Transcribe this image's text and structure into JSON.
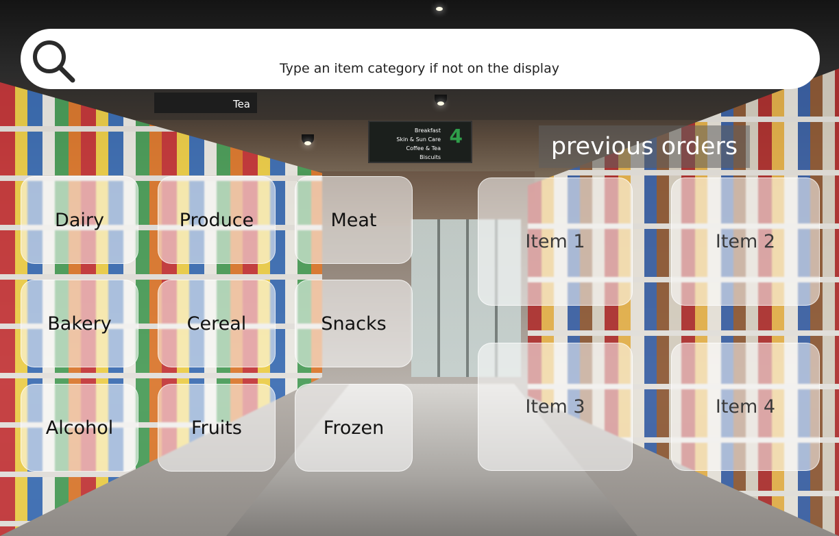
{
  "search": {
    "placeholder": "Type an item category if not on the display",
    "icon": "search-icon"
  },
  "background": {
    "tea_sign": "Tea",
    "aisle_sign": {
      "lines": [
        "Breakfast",
        "Skin & Sun Care",
        "Coffee & Tea",
        "Biscuits"
      ],
      "number": "4"
    }
  },
  "categories": [
    {
      "label": "Dairy"
    },
    {
      "label": "Produce"
    },
    {
      "label": "Meat"
    },
    {
      "label": "Bakery"
    },
    {
      "label": "Cereal"
    },
    {
      "label": "Snacks"
    },
    {
      "label": "Alcohol"
    },
    {
      "label": "Fruits"
    },
    {
      "label": "Frozen"
    }
  ],
  "previous_orders": {
    "title": "previous orders",
    "items": [
      {
        "label": "Item 1"
      },
      {
        "label": "Item 2"
      },
      {
        "label": "Item 3"
      },
      {
        "label": "Item 4"
      }
    ]
  }
}
